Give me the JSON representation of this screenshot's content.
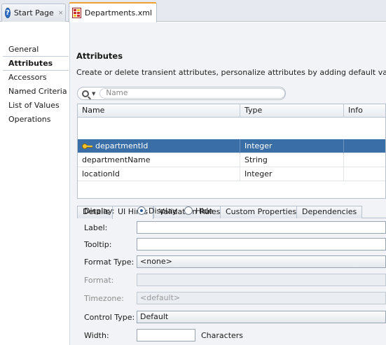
{
  "tabs": [
    {
      "label": "Start Page",
      "icon": "help-icon",
      "close": "×"
    },
    {
      "label": "Departments.xml",
      "icon": "xml-file-icon"
    }
  ],
  "nav": {
    "items": [
      "General",
      "Attributes",
      "Accessors",
      "Named Criteria",
      "List of Values",
      "Operations"
    ],
    "selected": "Attributes"
  },
  "section": {
    "title": "Attributes",
    "description": "Create or delete transient attributes, personalize attributes by adding default values, UI hin"
  },
  "search": {
    "placeholder": "Name"
  },
  "table": {
    "columns": [
      "Name",
      "Type",
      "Info"
    ],
    "rows": [
      {
        "name": "departmentId",
        "type": "Integer",
        "key": true,
        "selected": true
      },
      {
        "name": "departmentName",
        "type": "String"
      },
      {
        "name": "locationId",
        "type": "Integer"
      }
    ]
  },
  "subtabs": [
    "Details",
    "UI Hints",
    "Validation Rules",
    "Custom Properties",
    "Dependencies"
  ],
  "subtab_active": "UI Hints",
  "form": {
    "display_label": "Display:",
    "display_option": "Display",
    "hide_option": "Hide",
    "display_selected": "Display",
    "label_label": "Label:",
    "tooltip_label": "Tooltip:",
    "format_type_label": "Format Type:",
    "format_type_value": "<none>",
    "format_label": "Format:",
    "timezone_label": "Timezone:",
    "timezone_value": "<default>",
    "control_type_label": "Control Type:",
    "control_type_value": "Default",
    "width_label": "Width:",
    "width_unit": "Characters"
  },
  "colors": {
    "selection": "#3a6ea6",
    "active_tab_accent": "#f0a030"
  }
}
